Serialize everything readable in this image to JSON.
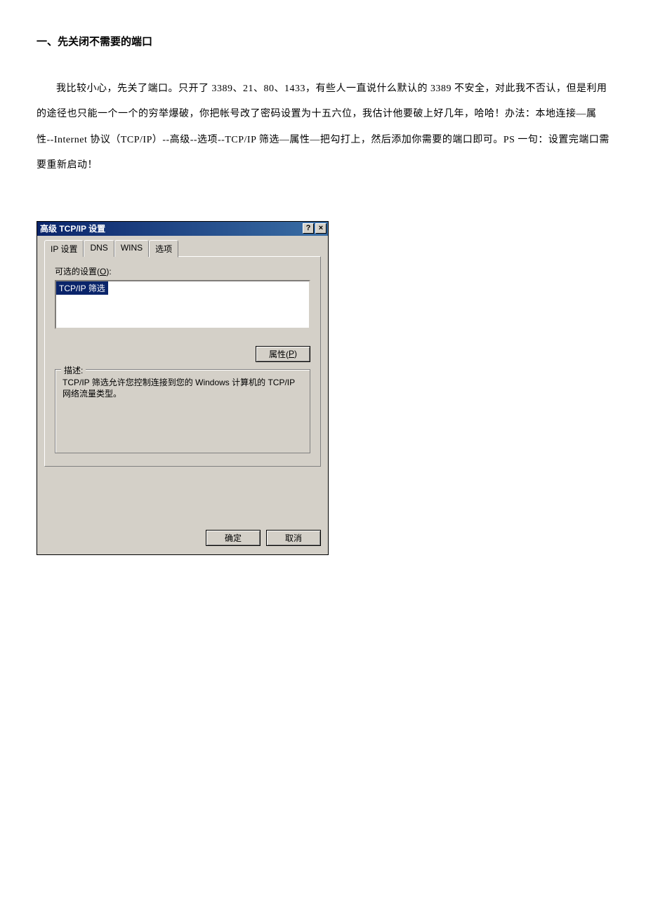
{
  "doc": {
    "heading": "一、先关闭不需要的端口",
    "paragraph": "我比较小心，先关了端口。只开了 3389、21、80、1433，有些人一直说什么默认的 3389 不安全，对此我不否认，但是利用的途径也只能一个一个的穷举爆破，你把帐号改了密码设置为十五六位，我估计他要破上好几年，哈哈！办法：本地连接—属性--Internet 协议（TCP/IP）--高级--选项--TCP/IP 筛选—属性—把勾打上，然后添加你需要的端口即可。PS 一句：设置完端口需要重新启动！"
  },
  "dialog": {
    "title": "高级 TCP/IP 设置",
    "help_btn": "?",
    "close_btn": "×",
    "tabs": {
      "ip": "IP 设置",
      "dns": "DNS",
      "wins": "WINS",
      "options": "选项"
    },
    "optional_label_pre": "可选的设置(",
    "optional_label_u": "O",
    "optional_label_post": "):",
    "list_item": "TCP/IP 筛选",
    "properties_btn_pre": "属性(",
    "properties_btn_u": "P",
    "properties_btn_post": ")",
    "group_legend": "描述:",
    "description": "TCP/IP 筛选允许您控制连接到您的 Windows 计算机的 TCP/IP 网络流量类型。",
    "ok_btn": "确定",
    "cancel_btn": "取消"
  }
}
